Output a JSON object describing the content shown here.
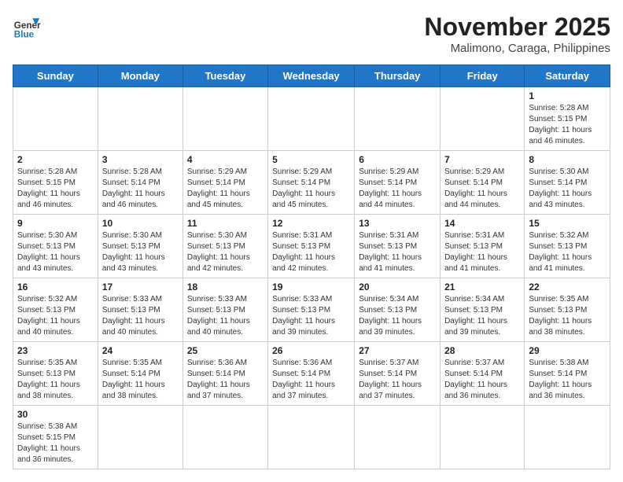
{
  "logo": {
    "text_general": "General",
    "text_blue": "Blue"
  },
  "header": {
    "title": "November 2025",
    "subtitle": "Malimono, Caraga, Philippines"
  },
  "weekdays": [
    "Sunday",
    "Monday",
    "Tuesday",
    "Wednesday",
    "Thursday",
    "Friday",
    "Saturday"
  ],
  "weeks": [
    [
      {
        "day": "",
        "info": ""
      },
      {
        "day": "",
        "info": ""
      },
      {
        "day": "",
        "info": ""
      },
      {
        "day": "",
        "info": ""
      },
      {
        "day": "",
        "info": ""
      },
      {
        "day": "",
        "info": ""
      },
      {
        "day": "1",
        "info": "Sunrise: 5:28 AM\nSunset: 5:15 PM\nDaylight: 11 hours\nand 46 minutes."
      }
    ],
    [
      {
        "day": "2",
        "info": "Sunrise: 5:28 AM\nSunset: 5:15 PM\nDaylight: 11 hours\nand 46 minutes."
      },
      {
        "day": "3",
        "info": "Sunrise: 5:28 AM\nSunset: 5:14 PM\nDaylight: 11 hours\nand 46 minutes."
      },
      {
        "day": "4",
        "info": "Sunrise: 5:29 AM\nSunset: 5:14 PM\nDaylight: 11 hours\nand 45 minutes."
      },
      {
        "day": "5",
        "info": "Sunrise: 5:29 AM\nSunset: 5:14 PM\nDaylight: 11 hours\nand 45 minutes."
      },
      {
        "day": "6",
        "info": "Sunrise: 5:29 AM\nSunset: 5:14 PM\nDaylight: 11 hours\nand 44 minutes."
      },
      {
        "day": "7",
        "info": "Sunrise: 5:29 AM\nSunset: 5:14 PM\nDaylight: 11 hours\nand 44 minutes."
      },
      {
        "day": "8",
        "info": "Sunrise: 5:30 AM\nSunset: 5:14 PM\nDaylight: 11 hours\nand 43 minutes."
      }
    ],
    [
      {
        "day": "9",
        "info": "Sunrise: 5:30 AM\nSunset: 5:13 PM\nDaylight: 11 hours\nand 43 minutes."
      },
      {
        "day": "10",
        "info": "Sunrise: 5:30 AM\nSunset: 5:13 PM\nDaylight: 11 hours\nand 43 minutes."
      },
      {
        "day": "11",
        "info": "Sunrise: 5:30 AM\nSunset: 5:13 PM\nDaylight: 11 hours\nand 42 minutes."
      },
      {
        "day": "12",
        "info": "Sunrise: 5:31 AM\nSunset: 5:13 PM\nDaylight: 11 hours\nand 42 minutes."
      },
      {
        "day": "13",
        "info": "Sunrise: 5:31 AM\nSunset: 5:13 PM\nDaylight: 11 hours\nand 41 minutes."
      },
      {
        "day": "14",
        "info": "Sunrise: 5:31 AM\nSunset: 5:13 PM\nDaylight: 11 hours\nand 41 minutes."
      },
      {
        "day": "15",
        "info": "Sunrise: 5:32 AM\nSunset: 5:13 PM\nDaylight: 11 hours\nand 41 minutes."
      }
    ],
    [
      {
        "day": "16",
        "info": "Sunrise: 5:32 AM\nSunset: 5:13 PM\nDaylight: 11 hours\nand 40 minutes."
      },
      {
        "day": "17",
        "info": "Sunrise: 5:33 AM\nSunset: 5:13 PM\nDaylight: 11 hours\nand 40 minutes."
      },
      {
        "day": "18",
        "info": "Sunrise: 5:33 AM\nSunset: 5:13 PM\nDaylight: 11 hours\nand 40 minutes."
      },
      {
        "day": "19",
        "info": "Sunrise: 5:33 AM\nSunset: 5:13 PM\nDaylight: 11 hours\nand 39 minutes."
      },
      {
        "day": "20",
        "info": "Sunrise: 5:34 AM\nSunset: 5:13 PM\nDaylight: 11 hours\nand 39 minutes."
      },
      {
        "day": "21",
        "info": "Sunrise: 5:34 AM\nSunset: 5:13 PM\nDaylight: 11 hours\nand 39 minutes."
      },
      {
        "day": "22",
        "info": "Sunrise: 5:35 AM\nSunset: 5:13 PM\nDaylight: 11 hours\nand 38 minutes."
      }
    ],
    [
      {
        "day": "23",
        "info": "Sunrise: 5:35 AM\nSunset: 5:13 PM\nDaylight: 11 hours\nand 38 minutes."
      },
      {
        "day": "24",
        "info": "Sunrise: 5:35 AM\nSunset: 5:14 PM\nDaylight: 11 hours\nand 38 minutes."
      },
      {
        "day": "25",
        "info": "Sunrise: 5:36 AM\nSunset: 5:14 PM\nDaylight: 11 hours\nand 37 minutes."
      },
      {
        "day": "26",
        "info": "Sunrise: 5:36 AM\nSunset: 5:14 PM\nDaylight: 11 hours\nand 37 minutes."
      },
      {
        "day": "27",
        "info": "Sunrise: 5:37 AM\nSunset: 5:14 PM\nDaylight: 11 hours\nand 37 minutes."
      },
      {
        "day": "28",
        "info": "Sunrise: 5:37 AM\nSunset: 5:14 PM\nDaylight: 11 hours\nand 36 minutes."
      },
      {
        "day": "29",
        "info": "Sunrise: 5:38 AM\nSunset: 5:14 PM\nDaylight: 11 hours\nand 36 minutes."
      }
    ],
    [
      {
        "day": "30",
        "info": "Sunrise: 5:38 AM\nSunset: 5:15 PM\nDaylight: 11 hours\nand 36 minutes."
      },
      {
        "day": "",
        "info": ""
      },
      {
        "day": "",
        "info": ""
      },
      {
        "day": "",
        "info": ""
      },
      {
        "day": "",
        "info": ""
      },
      {
        "day": "",
        "info": ""
      },
      {
        "day": "",
        "info": ""
      }
    ]
  ]
}
